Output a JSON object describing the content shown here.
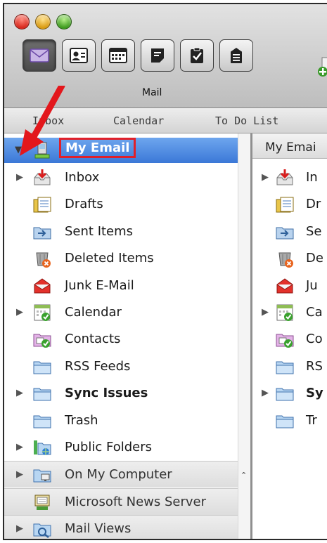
{
  "toolbar": {
    "active_label": "Mail",
    "buttons": [
      {
        "icon": "mail-icon"
      },
      {
        "icon": "address-book-icon"
      },
      {
        "icon": "calendar-icon"
      },
      {
        "icon": "notes-icon"
      },
      {
        "icon": "tasks-icon"
      },
      {
        "icon": "project-gallery-icon"
      }
    ]
  },
  "tabs": [
    "Inbox",
    "Calendar",
    "To Do List"
  ],
  "sidebar": {
    "selected": {
      "label": "My Email",
      "icon": "mail-account-icon"
    },
    "items": [
      {
        "label": "Inbox",
        "icon": "inbox-icon",
        "disclosure": true,
        "bold": false
      },
      {
        "label": "Drafts",
        "icon": "drafts-icon",
        "disclosure": false,
        "bold": false
      },
      {
        "label": "Sent Items",
        "icon": "sent-items-icon",
        "disclosure": false,
        "bold": false
      },
      {
        "label": "Deleted Items",
        "icon": "deleted-items-icon",
        "disclosure": false,
        "bold": false
      },
      {
        "label": "Junk E-Mail",
        "icon": "junk-mail-icon",
        "disclosure": false,
        "bold": false
      },
      {
        "label": "Calendar",
        "icon": "calendar-folder-icon",
        "disclosure": true,
        "bold": false
      },
      {
        "label": "Contacts",
        "icon": "contacts-folder-icon",
        "disclosure": false,
        "bold": false
      },
      {
        "label": "RSS Feeds",
        "icon": "folder-icon",
        "disclosure": false,
        "bold": false
      },
      {
        "label": "Sync Issues",
        "icon": "folder-icon",
        "disclosure": true,
        "bold": true
      },
      {
        "label": "Trash",
        "icon": "folder-icon",
        "disclosure": false,
        "bold": false
      },
      {
        "label": "Public Folders",
        "icon": "public-folders-icon",
        "disclosure": true,
        "bold": false
      }
    ],
    "sections": [
      {
        "label": "On My Computer",
        "icon": "computer-folder-icon",
        "disclosure": true
      },
      {
        "label": "Microsoft News Server",
        "icon": "news-server-icon",
        "disclosure": false
      },
      {
        "label": "Mail Views",
        "icon": "mail-views-icon",
        "disclosure": true
      }
    ]
  },
  "right_pane": {
    "header": "My Emai",
    "items": [
      {
        "label": "In",
        "icon": "inbox-icon",
        "disclosure": true,
        "bold": false
      },
      {
        "label": "Dr",
        "icon": "drafts-icon",
        "disclosure": false,
        "bold": false
      },
      {
        "label": "Se",
        "icon": "sent-items-icon",
        "disclosure": false,
        "bold": false
      },
      {
        "label": "De",
        "icon": "deleted-items-icon",
        "disclosure": false,
        "bold": false
      },
      {
        "label": "Ju",
        "icon": "junk-mail-icon",
        "disclosure": false,
        "bold": false
      },
      {
        "label": "Ca",
        "icon": "calendar-folder-icon",
        "disclosure": true,
        "bold": false
      },
      {
        "label": "Co",
        "icon": "contacts-folder-icon",
        "disclosure": false,
        "bold": false
      },
      {
        "label": "RS",
        "icon": "folder-icon",
        "disclosure": false,
        "bold": false
      },
      {
        "label": "Sy",
        "icon": "folder-icon",
        "disclosure": true,
        "bold": true
      },
      {
        "label": "Tr",
        "icon": "folder-icon",
        "disclosure": false,
        "bold": false
      }
    ]
  },
  "colors": {
    "selection_blue": "#3b78d7",
    "highlight_red": "#e0202a",
    "annotation_arrow": "#e3171c"
  }
}
